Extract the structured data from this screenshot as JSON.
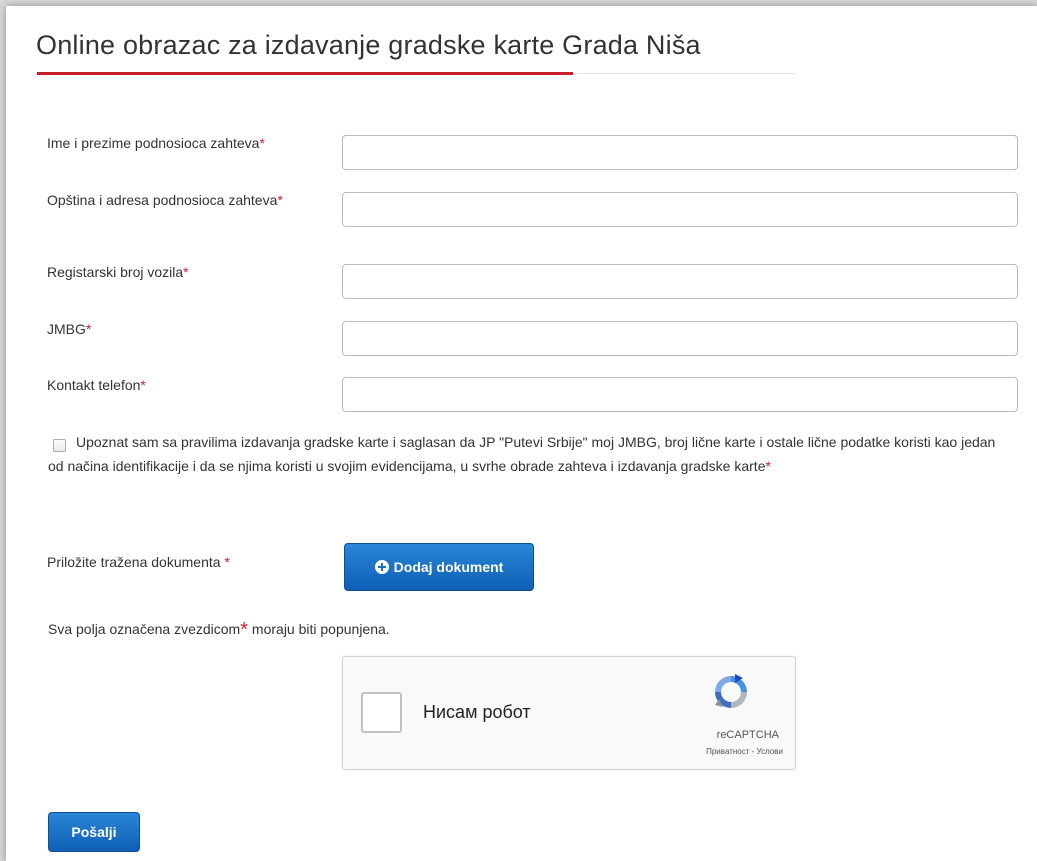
{
  "form": {
    "title": "Online obrazac za izdavanje gradske karte Grada Niša",
    "required_mark": "*",
    "fields": [
      {
        "label": "Ime i prezime podnosioca zahteva",
        "value": "",
        "placeholder": ""
      },
      {
        "label": "Opština i adresa podnosioca zahteva",
        "value": "",
        "placeholder": ""
      },
      {
        "label": "Registarski broj vozila",
        "value": "",
        "placeholder": ""
      },
      {
        "label": "JMBG",
        "value": "",
        "placeholder": ""
      },
      {
        "label": "Kontakt telefon",
        "value": "",
        "placeholder": ""
      }
    ],
    "consent": {
      "text": "Upoznat sam sa pravilima izdavanja gradske karte i saglasan da JP \"Putevi Srbije\" moj JMBG, broj lične karte i ostale lične podatke koristi kao jedan od načina identifikacije i da se njima koristi u svojim evidencijama, u svrhe obrade zahteva i izdavanja gradske karte",
      "checked": false
    },
    "documents": {
      "label": "Priložite tražena dokumenta ",
      "button_label": "Dodaj dokument",
      "icon": "plus-circle-icon"
    },
    "note_before": "Sva polja označena zvezdicom",
    "note_after": " moraju biti popunjena.",
    "recaptcha": {
      "label": "Нисам робот",
      "brand": "reCAPTCHA",
      "links": "Приватност - Услови",
      "checked": false
    },
    "submit_label": "Pošalji"
  },
  "colors": {
    "accent_red": "#c8202f",
    "primary_blue": "#1a70c4"
  }
}
